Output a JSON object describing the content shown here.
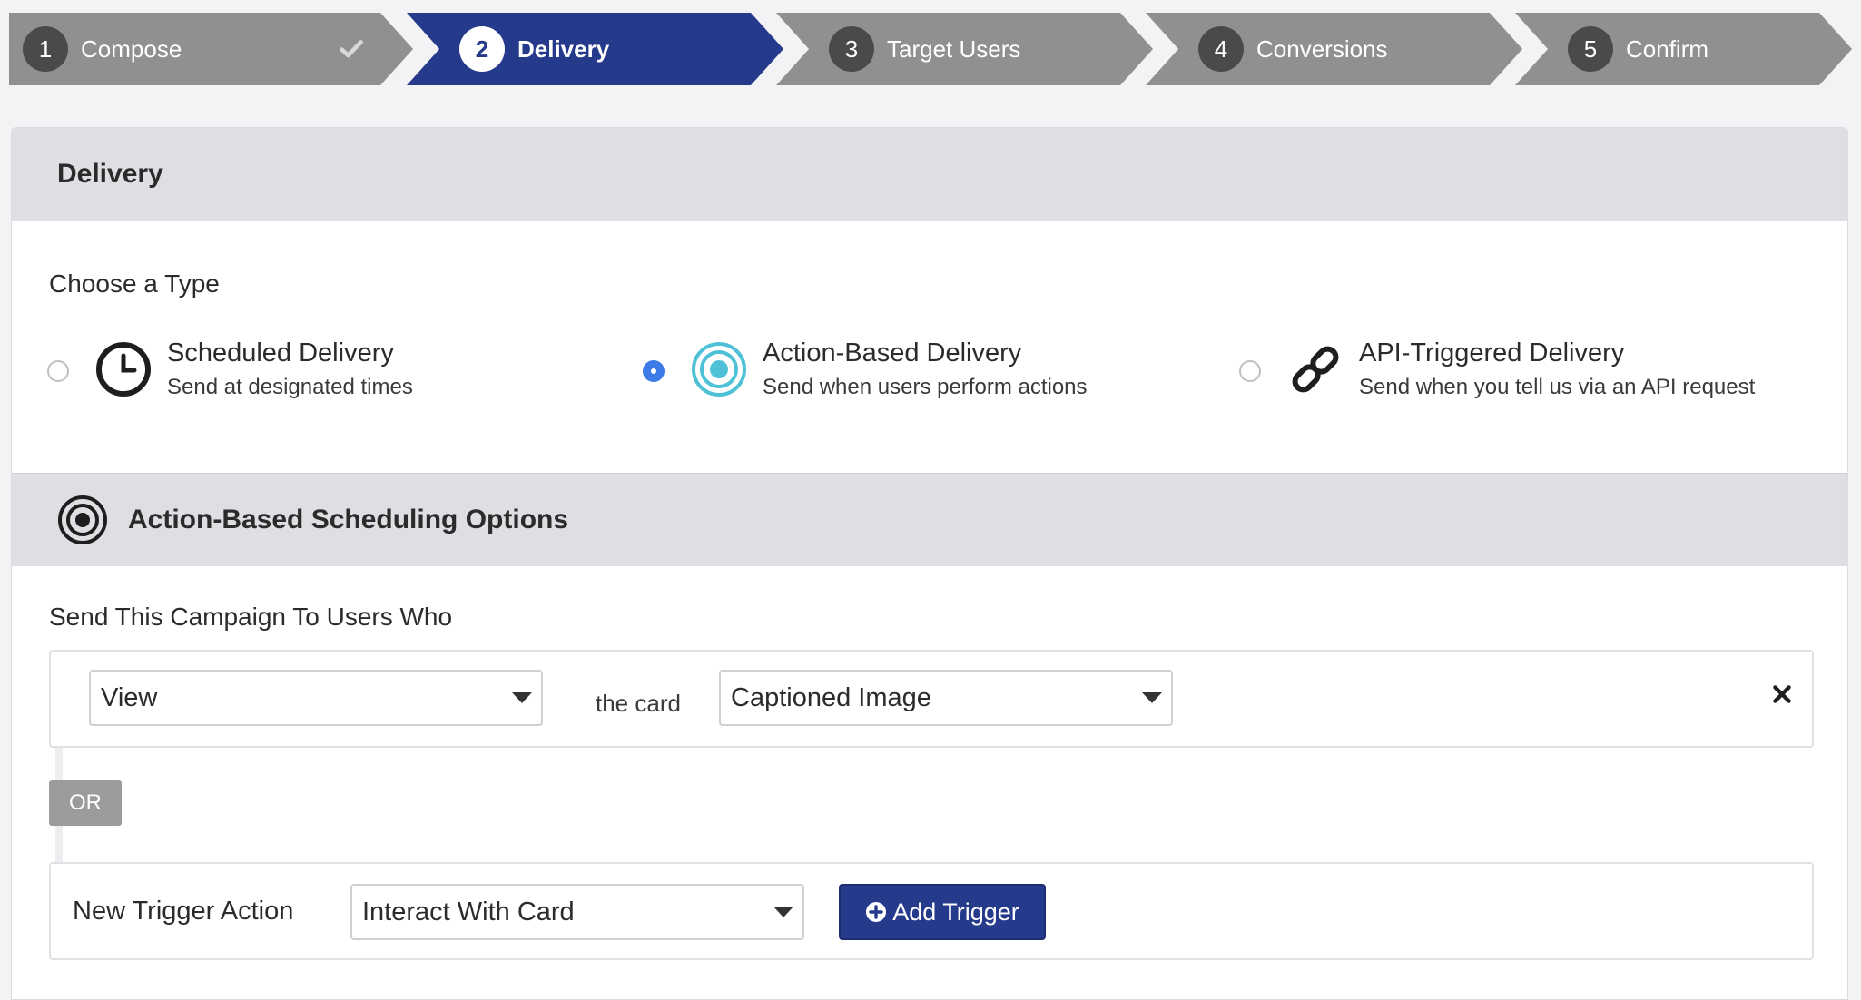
{
  "steps": [
    {
      "num": "1",
      "label": "Compose",
      "state": "done"
    },
    {
      "num": "2",
      "label": "Delivery",
      "state": "active"
    },
    {
      "num": "3",
      "label": "Target Users",
      "state": "pending"
    },
    {
      "num": "4",
      "label": "Conversions",
      "state": "pending"
    },
    {
      "num": "5",
      "label": "Confirm",
      "state": "pending"
    }
  ],
  "delivery": {
    "header": "Delivery",
    "choose_label": "Choose a Type",
    "options": [
      {
        "title": "Scheduled Delivery",
        "desc": "Send at designated times",
        "icon": "clock-icon",
        "selected": false
      },
      {
        "title": "Action-Based Delivery",
        "desc": "Send when users perform actions",
        "icon": "target-icon",
        "selected": true
      },
      {
        "title": "API-Triggered Delivery",
        "desc": "Send when you tell us via an API request",
        "icon": "link-icon",
        "selected": false
      }
    ]
  },
  "scheduling": {
    "header": "Action-Based Scheduling Options",
    "send_label": "Send This Campaign To Users Who",
    "trigger": {
      "action": "View",
      "connector_text": "the card",
      "card": "Captioned Image"
    },
    "or_label": "OR",
    "new_trigger": {
      "label": "New Trigger Action",
      "selected": "Interact With Card",
      "add_button": "Add Trigger"
    }
  },
  "colors": {
    "active_step": "#263a8c",
    "inactive_step": "#909092",
    "radio_selected": "#3d7be8",
    "target_icon": "#4ec1d6",
    "header_bg": "#dedee3"
  }
}
